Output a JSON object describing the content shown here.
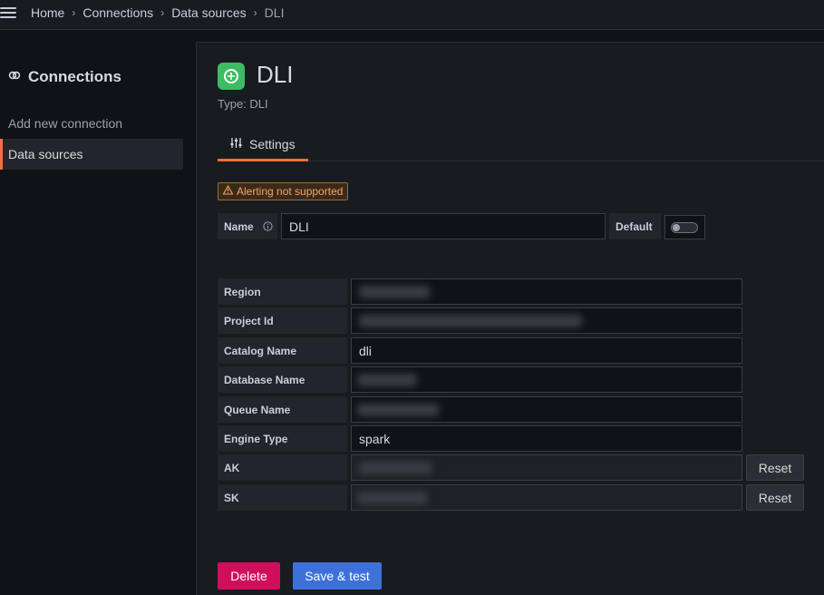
{
  "breadcrumb": {
    "items": [
      "Home",
      "Connections",
      "Data sources",
      "DLI"
    ]
  },
  "sidebar": {
    "title": "Connections",
    "items": [
      {
        "label": "Add new connection"
      },
      {
        "label": "Data sources"
      }
    ]
  },
  "datasource": {
    "title": "DLI",
    "type_text": "Type: DLI",
    "settings_tab": "Settings",
    "alert_badge": "Alerting not supported",
    "name_label": "Name",
    "name_value": "DLI",
    "default_label": "Default",
    "default_enabled": false
  },
  "fields": [
    {
      "label": "Region",
      "value": ""
    },
    {
      "label": "Project Id",
      "value": ""
    },
    {
      "label": "Catalog Name",
      "value": "dli"
    },
    {
      "label": "Database Name",
      "value": ""
    },
    {
      "label": "Queue Name",
      "value": ""
    },
    {
      "label": "Engine Type",
      "value": "spark"
    },
    {
      "label": "AK",
      "value": "",
      "reset_label": "Reset"
    },
    {
      "label": "SK",
      "value": "",
      "reset_label": "Reset"
    }
  ],
  "actions": {
    "delete_label": "Delete",
    "save_label": "Save & test"
  },
  "colors": {
    "accent": "#f46f3c",
    "delete": "#d10e5c",
    "primary": "#3d71d9",
    "logo_bg": "#3cbc63"
  }
}
